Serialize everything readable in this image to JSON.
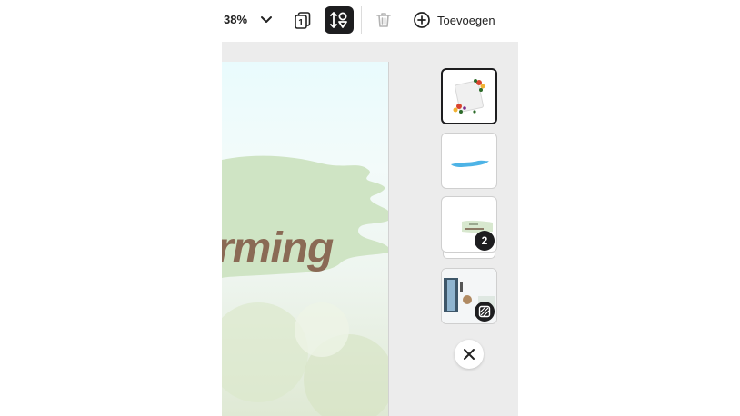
{
  "toolbar": {
    "zoom": "38%",
    "page_count_badge": "1",
    "add_label": "Toevoegen"
  },
  "canvas": {
    "visible_text": "rming"
  },
  "thumbnails": [
    {
      "id": "page-1",
      "selected": true
    },
    {
      "id": "page-2",
      "selected": false
    },
    {
      "id": "page-3",
      "selected": false,
      "badge": "2"
    },
    {
      "id": "page-4",
      "selected": false,
      "badge_icon": "video-icon"
    }
  ],
  "colors": {
    "accent_dark": "#1d1d1f",
    "workspace_bg": "#ececec",
    "text_brown": "#8a6a55",
    "leaf_green": "#cfe4c4"
  }
}
